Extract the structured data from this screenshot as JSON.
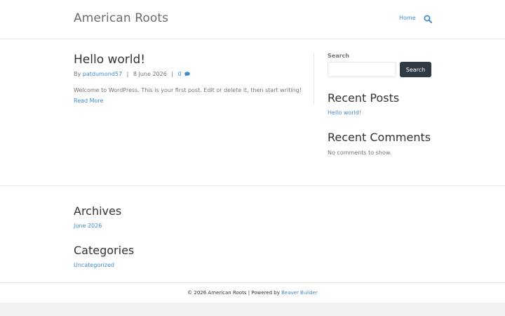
{
  "header": {
    "site_title": "American Roots",
    "nav": {
      "home_label": "Home"
    },
    "search_icon": "search-icon"
  },
  "post": {
    "title": "Hello world!",
    "meta": {
      "by_label": "By",
      "author": "patdumond57",
      "separator": "|",
      "date": "8 June 2026",
      "comment_count": "0",
      "comment_icon": "comment-icon"
    },
    "excerpt": "Welcome to WordPress. This is your first post. Edit or delete it, then start writing!",
    "read_more_label": "Read More"
  },
  "sidebar": {
    "search": {
      "label": "Search",
      "input_value": "",
      "input_placeholder": "",
      "button_label": "Search"
    },
    "recent_posts": {
      "heading": "Recent Posts",
      "items": [
        "Hello world!"
      ]
    },
    "recent_comments": {
      "heading": "Recent Comments",
      "empty_text": "No comments to show."
    }
  },
  "footer_widgets": {
    "archives": {
      "heading": "Archives",
      "items": [
        "June 2026"
      ]
    },
    "categories": {
      "heading": "Categories",
      "items": [
        "Uncategorized"
      ]
    }
  },
  "footer": {
    "copyright": "© 2026 American Roots | Powered by",
    "builder_link": "Beaver Builder"
  },
  "colors": {
    "accent": "#428bca",
    "button_bg": "#2f3a44",
    "heading": "#333333",
    "body_text": "#757575",
    "border": "#e6e6e6"
  }
}
